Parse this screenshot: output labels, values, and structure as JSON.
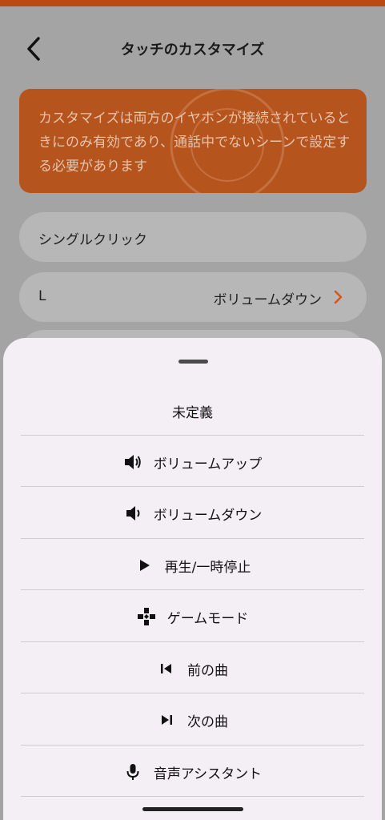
{
  "header": {
    "title": "タッチのカスタマイズ",
    "back_icon": "chevron-left-icon"
  },
  "notice": {
    "text": "カスタマイズは両方のイヤホンが接続されているときにのみ有効であり、通話中でないシーンで設定する必要があります",
    "color": "#b5541d"
  },
  "settings": {
    "section_label": "シングルクリック",
    "row_l": {
      "label": "L",
      "value": "ボリュームダウン"
    }
  },
  "sheet": {
    "options": [
      {
        "label": "未定義",
        "icon": ""
      },
      {
        "label": "ボリュームアップ",
        "icon": "volume-up-icon"
      },
      {
        "label": "ボリュームダウン",
        "icon": "volume-down-icon"
      },
      {
        "label": "再生/一時停止",
        "icon": "play-icon"
      },
      {
        "label": "ゲームモード",
        "icon": "gamepad-icon"
      },
      {
        "label": "前の曲",
        "icon": "previous-track-icon"
      },
      {
        "label": "次の曲",
        "icon": "next-track-icon"
      },
      {
        "label": "音声アシスタント",
        "icon": "microphone-icon"
      }
    ]
  },
  "colors": {
    "accent": "#e0581c",
    "sheet_bg": "#f3eff5",
    "overlay": "#a4a4a4"
  }
}
